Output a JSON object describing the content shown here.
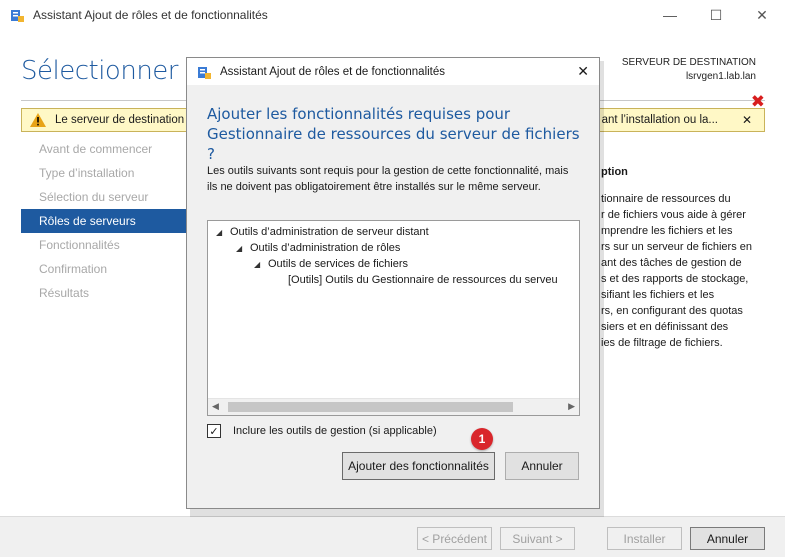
{
  "outer": {
    "title": "Assistant Ajout de rôles et de fonctionnalités",
    "page_title": "Sélectionner des",
    "dest_label": "SERVEUR DE DESTINATION",
    "dest_server": "lsrvgen1.lab.lan",
    "warning_left": "Le serveur de destination",
    "warning_right": "ant l’installation ou la...",
    "warning_close": "✕",
    "nav": [
      {
        "label": "Avant de commencer",
        "active": false
      },
      {
        "label": "Type d’installation",
        "active": false
      },
      {
        "label": "Sélection du serveur",
        "active": false
      },
      {
        "label": "Rôles de serveurs",
        "active": true
      },
      {
        "label": "Fonctionnalités",
        "active": false
      },
      {
        "label": "Confirmation",
        "active": false
      },
      {
        "label": "Résultats",
        "active": false
      }
    ],
    "description": {
      "title": "ption",
      "text": "tionnaire de ressources du\nr de fichiers vous aide à gérer\nmprendre les fichiers et les\nrs sur un serveur de fichiers en\nant des tâches de gestion de\ns et des rapports de stockage,\nsifiant les fichiers et les\nrs, en configurant des quotas\nsiers et en définissant des\nies de filtrage de fichiers."
    },
    "buttons": {
      "previous": "< Précédent",
      "next": "Suivant >",
      "install": "Installer",
      "cancel": "Annuler"
    }
  },
  "modal": {
    "title": "Assistant Ajout de rôles et de fonctionnalités",
    "close": "✕",
    "heading": "Ajouter les fonctionnalités requises pour Gestionnaire de ressources du serveur de fichiers ?",
    "description": "Les outils suivants sont requis pour la gestion de cette fonctionnalité, mais ils ne doivent pas obligatoirement être installés sur le même serveur.",
    "tree": [
      {
        "label": "Outils d’administration de serveur distant",
        "expanded": true
      },
      {
        "label": "Outils d’administration de rôles",
        "expanded": true
      },
      {
        "label": "Outils de services de fichiers",
        "expanded": true
      },
      {
        "label": "[Outils] Outils du Gestionnaire de ressources du serveu",
        "expanded": false
      }
    ],
    "checkbox_label": "Inclure les outils de gestion (si applicable)",
    "checkbox_checked": true,
    "add_button": "Ajouter des fonctionnalités",
    "cancel_button": "Annuler",
    "badge": "1"
  },
  "colors": {
    "accent": "#1e5aa0",
    "warning_bg": "#fff8c6",
    "badge": "#d9262b"
  }
}
